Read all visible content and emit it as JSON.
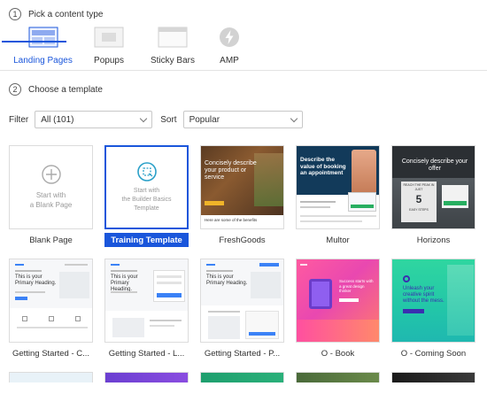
{
  "step1": {
    "number": "1",
    "label": "Pick a content type"
  },
  "content_types": [
    {
      "label": "Landing Pages",
      "icon": "landing-pages-icon",
      "active": true
    },
    {
      "label": "Popups",
      "icon": "popup-icon",
      "active": false
    },
    {
      "label": "Sticky Bars",
      "icon": "sticky-bar-icon",
      "active": false
    },
    {
      "label": "AMP",
      "icon": "amp-bolt-icon",
      "active": false
    }
  ],
  "step2": {
    "number": "2",
    "label": "Choose a template"
  },
  "filter": {
    "label": "Filter",
    "value": "All (101)"
  },
  "sort": {
    "label": "Sort",
    "value": "Popular"
  },
  "templates": [
    {
      "label": "Blank Page",
      "thumb_text": "Start with\na Blank Page"
    },
    {
      "label": "Training Template",
      "thumb_text": "Start with\nthe Builder Basics\nTemplate",
      "selected": true
    },
    {
      "label": "FreshGoods",
      "heading": "Concisely describe your product or service",
      "caption": "Here are some of the benefits"
    },
    {
      "label": "Multor",
      "heading": "Describe the value of booking an appointment"
    },
    {
      "label": "Horizons",
      "heading": "Concisely describe your offer",
      "badge": "REACH THE PEAK IN JUST",
      "number": "5",
      "steps": "EASY STEPS"
    },
    {
      "label": "Getting Started - C...",
      "heading": "This is your Primary Heading."
    },
    {
      "label": "Getting Started - L...",
      "heading": "This is your Primary Heading."
    },
    {
      "label": "Getting Started - P...",
      "heading": "This is your Primary Heading."
    },
    {
      "label": "O - Book",
      "heading": "Success starts with a great design thinker"
    },
    {
      "label": "O - Coming Soon",
      "heading": "Unleash your creative spirit without the mess."
    }
  ],
  "colors": {
    "accent": "#1a56db"
  }
}
